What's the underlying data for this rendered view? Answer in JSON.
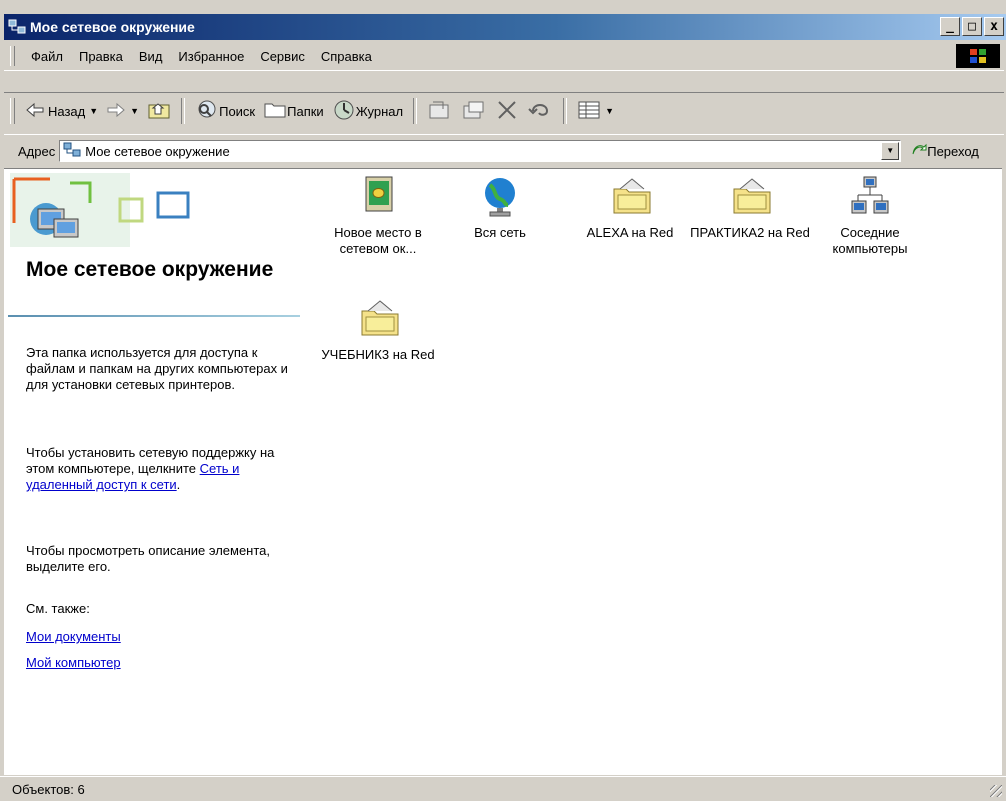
{
  "window": {
    "title": "Мое сетевое окружение",
    "controls": [
      "_",
      "□",
      "x"
    ]
  },
  "menu": [
    "Файл",
    "Правка",
    "Вид",
    "Избранное",
    "Сервис",
    "Справка"
  ],
  "toolbar": {
    "back": "Назад",
    "search": "Поиск",
    "folders": "Папки",
    "history": "Журнал"
  },
  "address": {
    "label": "Адрес",
    "value": "Мое сетевое окружение",
    "go": "Переход"
  },
  "left_pane": {
    "title": "Мое сетевое окружение",
    "desc1": "Эта папка используется для доступа к файлам и папкам на других компьютерах и для установки сетевых принтеров.",
    "desc2_prefix": "Чтобы установить сетевую поддержку на этом компьютере, щелкните ",
    "desc2_link": "Сеть и удаленный доступ к сети",
    "desc2_suffix": ".",
    "desc3": "Чтобы просмотреть описание элемента, выделите его.",
    "see_also": "См. также:",
    "links": [
      "Мои документы",
      "Мой компьютер"
    ]
  },
  "items": [
    {
      "label": "Новое место в сетевом ок...",
      "icon": "add-network-place-icon"
    },
    {
      "label": "Вся сеть",
      "icon": "globe-icon"
    },
    {
      "label": "ALEXA на Red",
      "icon": "shared-folder-icon"
    },
    {
      "label": "ПРАКТИКА2 на Red",
      "icon": "shared-folder-icon"
    },
    {
      "label": "Соседние компьютеры",
      "icon": "neighbor-computers-icon"
    },
    {
      "label": "УЧЕБНИК3 на Red",
      "icon": "shared-folder-icon"
    }
  ],
  "status": {
    "text": "Объектов: 6"
  },
  "colors": {
    "titlebar_start": "#0a246a",
    "titlebar_end": "#a6caf0",
    "link": "#0000cc",
    "chrome": "#d4d0c8"
  }
}
